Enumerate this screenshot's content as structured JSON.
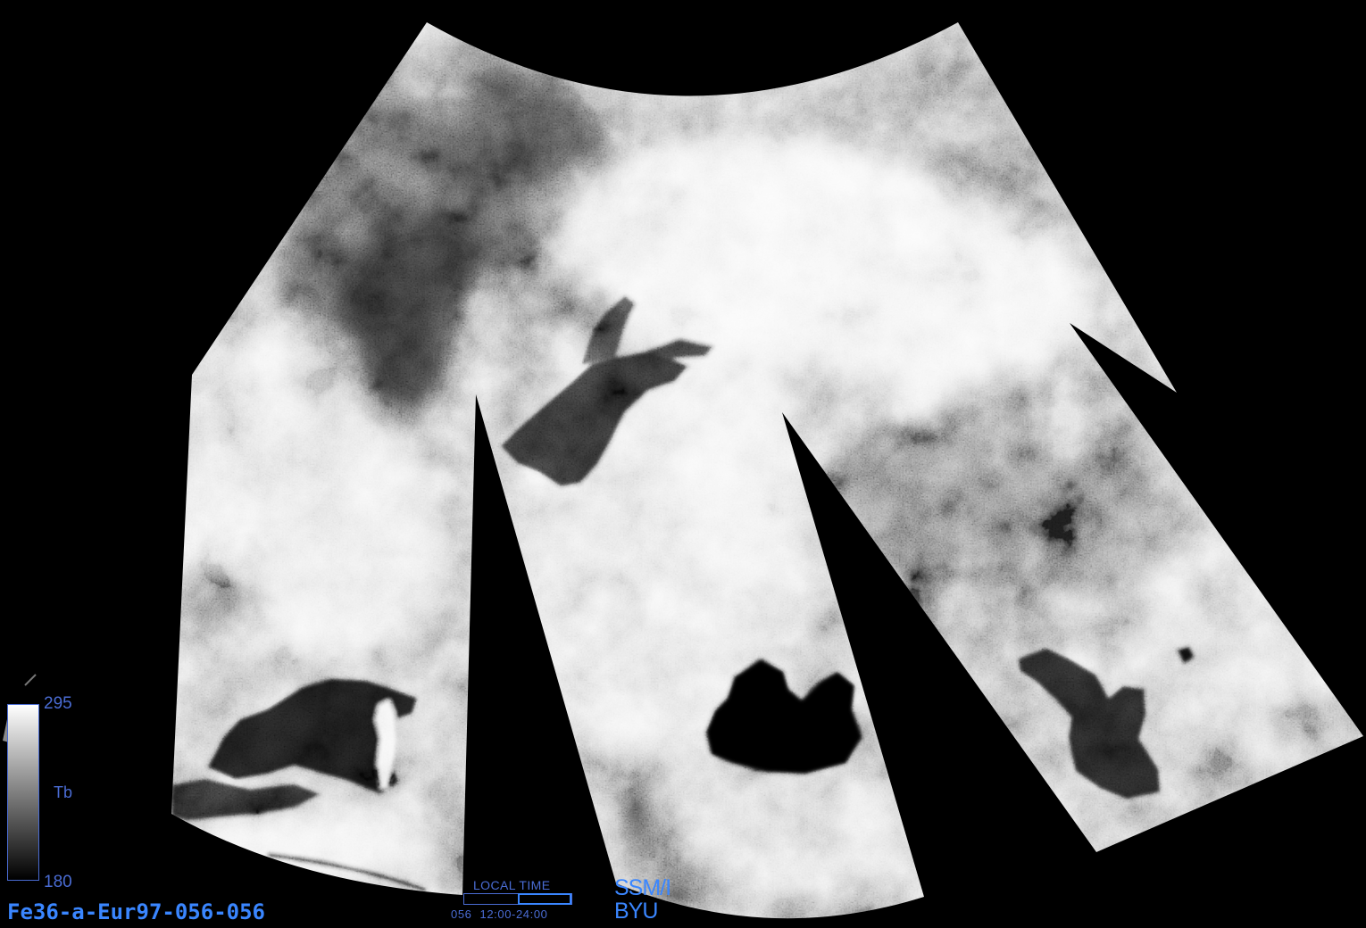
{
  "footer": {
    "file_id": "Fe36-a-Eur97-056-056"
  },
  "colorbar": {
    "variable": "Tb",
    "max_label": "295",
    "min_label": "180",
    "top_color": "#ffffff",
    "bottom_color": "#000000"
  },
  "local_time": {
    "label": "LOCAL TIME",
    "day": "056",
    "range": "12:00-24:00",
    "highlight_hours": [
      12,
      24
    ]
  },
  "sensor": {
    "name": "SSM/I",
    "org": "BYU"
  },
  "colors": {
    "label_blue": "#4a6cd4",
    "title_blue": "#3a86ff",
    "background": "#000000"
  }
}
